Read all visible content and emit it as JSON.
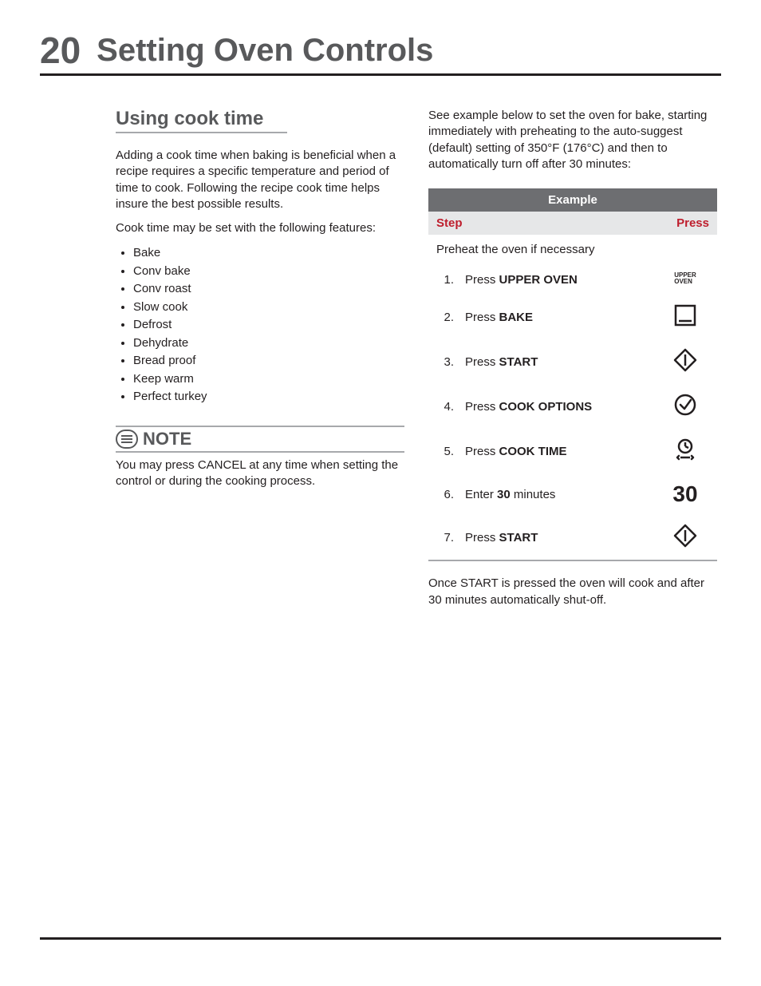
{
  "page_number": "20",
  "title": "Setting Oven Controls",
  "section_heading": "Using cook time",
  "intro_p1": "Adding a cook time when baking is beneficial when a recipe requires a specific temperature and period of time to cook. Following the recipe cook time helps insure the best possible results.",
  "intro_p2": "Cook time may be set with the following features:",
  "features": [
    "Bake",
    "Conv bake",
    "Conv roast",
    "Slow cook",
    "Defrost",
    "Dehydrate",
    "Bread proof",
    "Keep warm",
    "Perfect turkey"
  ],
  "note_label": "NOTE",
  "note_body": "You may press CANCEL at any time when setting the control or during the cooking process.",
  "right_intro": "See example below to set the oven for bake, starting immediately with preheating to the auto-suggest (default) setting of 350°F (176°C) and then to automatically turn off after 30 minutes:",
  "table": {
    "title": "Example",
    "col_step": "Step",
    "col_press": "Press",
    "preheat_row": "Preheat the oven if necessary",
    "rows": [
      {
        "n": "1.",
        "pre": "Press ",
        "bold": "UPPER OVEN",
        "post": "",
        "icon": "upper-oven"
      },
      {
        "n": "2.",
        "pre": "Press ",
        "bold": "BAKE",
        "post": "",
        "icon": "bake"
      },
      {
        "n": "3.",
        "pre": "Press ",
        "bold": "START",
        "post": "",
        "icon": "start"
      },
      {
        "n": "4.",
        "pre": "Press ",
        "bold": "COOK OPTIONS",
        "post": "",
        "icon": "cook-options"
      },
      {
        "n": "5.",
        "pre": "Press ",
        "bold": "COOK TIME",
        "post": "",
        "icon": "cook-time"
      },
      {
        "n": "6.",
        "pre": "Enter ",
        "bold": "30",
        "post": " minutes",
        "icon": "digit-30"
      },
      {
        "n": "7.",
        "pre": "Press ",
        "bold": "START",
        "post": "",
        "icon": "start"
      }
    ]
  },
  "upper_oven_label_l1": "UPPER",
  "upper_oven_label_l2": "OVEN",
  "digit_30": "30",
  "footer_p": "Once START is pressed the oven will cook and after 30 minutes automatically shut-off."
}
